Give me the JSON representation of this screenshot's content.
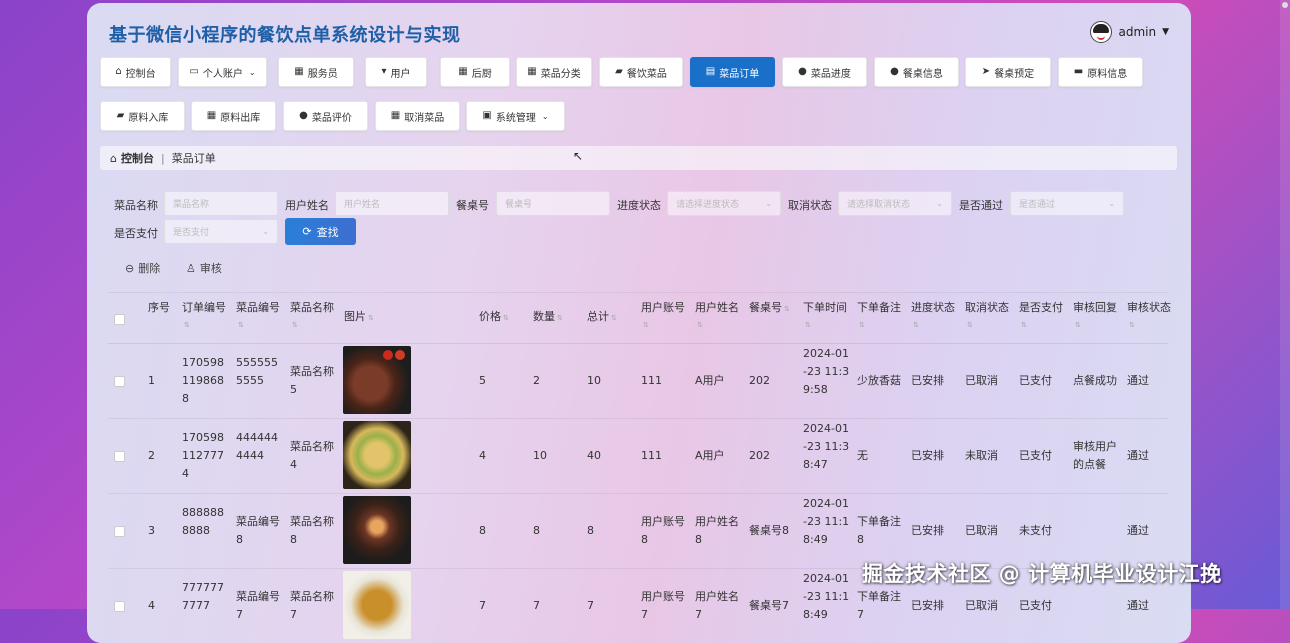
{
  "app": {
    "title": "基于微信小程序的餐饮点单系统设计与实现",
    "user": "admin"
  },
  "nav": [
    {
      "label": "控制台",
      "icon": "home-icon"
    },
    {
      "label": "个人账户",
      "icon": "account-icon",
      "dropdown": true
    },
    {
      "label": "服务员",
      "icon": "grid-icon"
    },
    {
      "label": "用户",
      "icon": "user-icon"
    },
    {
      "label": "后厨",
      "icon": "grid-icon"
    },
    {
      "label": "菜品分类",
      "icon": "apps-icon"
    },
    {
      "label": "餐饮菜品",
      "icon": "dish-icon"
    },
    {
      "label": "菜品订单",
      "icon": "clipboard-icon",
      "active": true
    },
    {
      "label": "菜品进度",
      "icon": "pin-icon"
    },
    {
      "label": "餐桌信息",
      "icon": "person-icon"
    },
    {
      "label": "餐桌预定",
      "icon": "send-icon"
    },
    {
      "label": "原料信息",
      "icon": "monitor-icon"
    },
    {
      "label": "原料入库",
      "icon": "box-icon"
    },
    {
      "label": "原料出库",
      "icon": "grid-icon"
    },
    {
      "label": "菜品评价",
      "icon": "person-icon"
    },
    {
      "label": "取消菜品",
      "icon": "grid-icon"
    },
    {
      "label": "系统管理",
      "icon": "gear-icon",
      "dropdown": true
    }
  ],
  "breadcrumb": {
    "home": "控制台",
    "current": "菜品订单"
  },
  "filters": {
    "dish_name": {
      "label": "菜品名称",
      "placeholder": "菜品名称"
    },
    "user_name": {
      "label": "用户姓名",
      "placeholder": "用户姓名"
    },
    "table_no": {
      "label": "餐桌号",
      "placeholder": "餐桌号"
    },
    "progress": {
      "label": "进度状态",
      "placeholder": "请选择进度状态"
    },
    "cancel": {
      "label": "取消状态",
      "placeholder": "请选择取消状态"
    },
    "passed": {
      "label": "是否通过",
      "placeholder": "是否通过"
    },
    "paid": {
      "label": "是否支付",
      "placeholder": "是否支付"
    },
    "search_label": "查找"
  },
  "actions": {
    "delete": "删除",
    "review": "审核"
  },
  "columns": [
    "序号",
    "订单编号",
    "菜品编号",
    "菜品名称",
    "图片",
    "价格",
    "数量",
    "总计",
    "用户账号",
    "用户姓名",
    "餐桌号",
    "下单时间",
    "下单备注",
    "进度状态",
    "取消状态",
    "是否支付",
    "审核回复",
    "审核状态"
  ],
  "rows": [
    {
      "idx": "1",
      "order_no": "1705981198688",
      "dish_no": "5555555555",
      "dish_name": "菜品名称5",
      "image": "steak",
      "price": "5",
      "qty": "2",
      "total": "10",
      "account": "111",
      "username": "A用户",
      "table": "202",
      "time": "2024-01-23 11:39:58",
      "note": "少放香菇",
      "progress": "已安排",
      "cancel": "已取消",
      "paid": "已支付",
      "reply": "点餐成功",
      "review": "通过"
    },
    {
      "idx": "2",
      "order_no": "1705981127774",
      "dish_no": "4444444444",
      "dish_name": "菜品名称4",
      "image": "salad",
      "price": "4",
      "qty": "10",
      "total": "40",
      "account": "111",
      "username": "A用户",
      "table": "202",
      "time": "2024-01-23 11:38:47",
      "note": "无",
      "progress": "已安排",
      "cancel": "未取消",
      "paid": "已支付",
      "reply": "审核用户的点餐",
      "review": "通过"
    },
    {
      "idx": "3",
      "order_no": "8888888888",
      "dish_no": "菜品编号8",
      "dish_name": "菜品名称8",
      "image": "noodles",
      "price": "8",
      "qty": "8",
      "total": "8",
      "account": "用户账号8",
      "username": "用户姓名8",
      "table": "餐桌号8",
      "time": "2024-01-23 11:18:49",
      "note": "下单备注8",
      "progress": "已安排",
      "cancel": "已取消",
      "paid": "未支付",
      "reply": "",
      "review": "通过"
    },
    {
      "idx": "4",
      "order_no": "7777777777",
      "dish_no": "菜品编号7",
      "dish_name": "菜品名称7",
      "image": "stirfry",
      "price": "7",
      "qty": "7",
      "total": "7",
      "account": "用户账号7",
      "username": "用户姓名7",
      "table": "餐桌号7",
      "time": "2024-01-23 11:18:49",
      "note": "下单备注7",
      "progress": "已安排",
      "cancel": "已取消",
      "paid": "已支付",
      "reply": "",
      "review": "通过"
    }
  ],
  "watermark": "掘金技术社区 @ 计算机毕业设计江挽"
}
